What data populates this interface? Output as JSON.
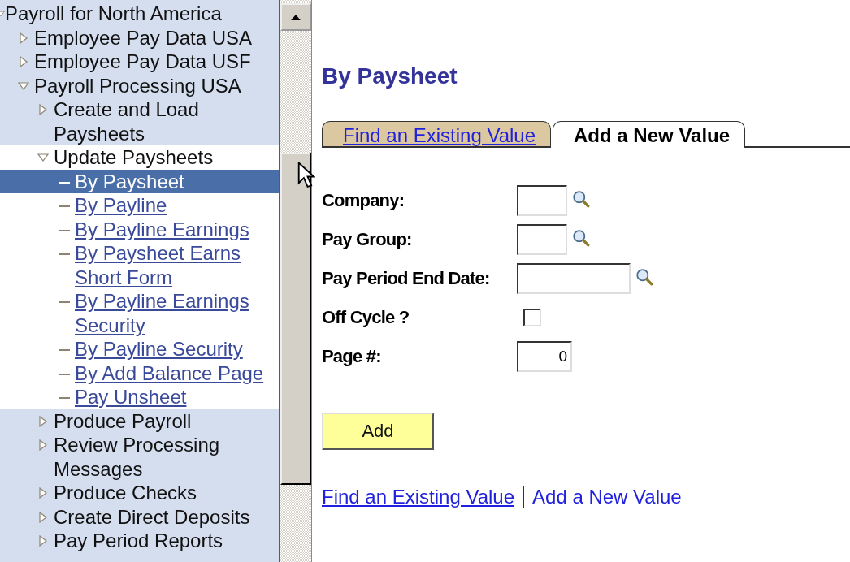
{
  "menu": [
    {
      "label": "Payroll for North America",
      "kind": "folder",
      "expanded": true,
      "selected": false,
      "children": [
        {
          "label": "Employee Pay Data USA",
          "kind": "folder",
          "expanded": false,
          "selected": false
        },
        {
          "label": "Employee Pay Data USF",
          "kind": "folder",
          "expanded": false,
          "selected": false
        },
        {
          "label": "Payroll Processing USA",
          "kind": "folder",
          "expanded": true,
          "selected": false,
          "children": [
            {
              "label": "Create and Load Paysheets",
              "kind": "folder",
              "expanded": false,
              "selected": false
            },
            {
              "label": "Update Paysheets",
              "kind": "folder",
              "expanded": true,
              "selected": false,
              "children": [
                {
                  "label": "By Paysheet",
                  "kind": "leaf",
                  "selected": true
                },
                {
                  "label": "By Payline",
                  "kind": "leaf",
                  "selected": false
                },
                {
                  "label": "By Payline Earnings",
                  "kind": "leaf",
                  "selected": false
                },
                {
                  "label": "By Paysheet Earns Short Form",
                  "kind": "leaf",
                  "selected": false
                },
                {
                  "label": "By Payline Earnings Security",
                  "kind": "leaf",
                  "selected": false
                },
                {
                  "label": "By Payline Security",
                  "kind": "leaf",
                  "selected": false
                },
                {
                  "label": "By Add Balance Page",
                  "kind": "leaf",
                  "selected": false
                },
                {
                  "label": "Pay Unsheet",
                  "kind": "leaf",
                  "selected": false
                }
              ]
            },
            {
              "label": "Produce Payroll",
              "kind": "folder",
              "expanded": false,
              "selected": false
            },
            {
              "label": "Review Processing Messages",
              "kind": "folder",
              "expanded": false,
              "selected": false
            },
            {
              "label": "Produce Checks",
              "kind": "folder",
              "expanded": false,
              "selected": false
            },
            {
              "label": "Create Direct Deposits",
              "kind": "folder",
              "expanded": false,
              "selected": false
            },
            {
              "label": "Pay Period Reports",
              "kind": "folder",
              "expanded": false,
              "selected": false
            }
          ]
        }
      ]
    }
  ],
  "page_title": "By Paysheet",
  "tabs": [
    {
      "label": "Find an Existing Value",
      "selected": false
    },
    {
      "label": "Add a New Value",
      "selected": true
    }
  ],
  "fields": [
    {
      "label": "Company:",
      "kind": "lookup"
    },
    {
      "label": "Pay Group:",
      "kind": "lookup"
    },
    {
      "label": "Pay Period End Date:",
      "kind": "date_lookup"
    },
    {
      "label": "Off Cycle ?",
      "kind": "checkbox",
      "checked": false
    },
    {
      "label": "Page #:",
      "kind": "number",
      "value": "0"
    }
  ],
  "add_button": "Add",
  "bottom_links": [
    {
      "label": "Find an Existing Value",
      "selected": false
    },
    {
      "label": "Add a New Value",
      "selected": true
    }
  ]
}
